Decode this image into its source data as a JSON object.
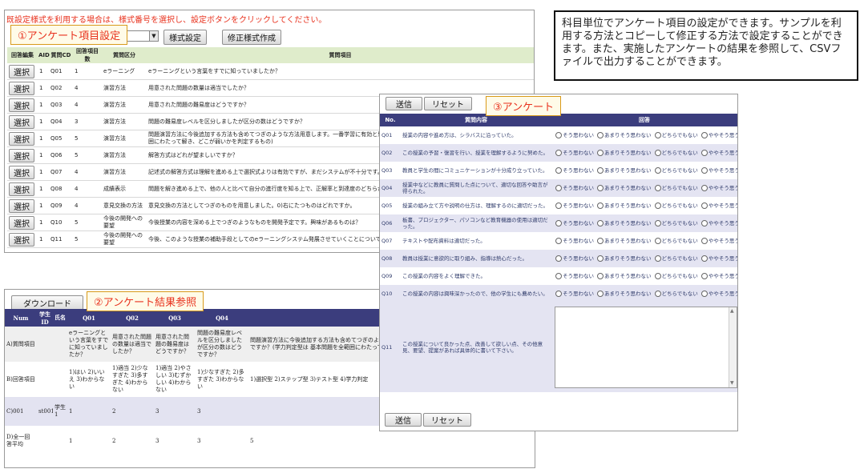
{
  "panel1": {
    "notice": "既設定様式を利用する場合は、様式番号を選択し、設定ボタンをクリックしてください。",
    "callout": "①アンケート項目設定",
    "style_button": "様式設定",
    "modify_button": "修正様式作成",
    "headers": [
      "回答編集",
      "AID",
      "質問CD",
      "回答項目数",
      "質問区分",
      "質問項目"
    ],
    "select_label": "選択",
    "rows": [
      {
        "aid": "1",
        "cd": "Q01",
        "n": "1",
        "cat": "eラーニング",
        "q": "eラーニングという言葉をすでに知っていましたか？"
      },
      {
        "aid": "1",
        "cd": "Q02",
        "n": "4",
        "cat": "演習方法",
        "q": "用意された問題の数量は適当でしたか？"
      },
      {
        "aid": "1",
        "cd": "Q03",
        "n": "4",
        "cat": "演習方法",
        "q": "用意された問題の難易度はどうですか？"
      },
      {
        "aid": "1",
        "cd": "Q04",
        "n": "3",
        "cat": "演習方法",
        "q": "問題の難易度レベルを区分しましたが区分の数はどうですか？"
      },
      {
        "aid": "1",
        "cd": "Q05",
        "n": "5",
        "cat": "演習方法",
        "q": "問題演習方法に今後追加する方法も含めてつぎのような方法用意します。一番学習に有効と思われるものはどれですか？(学力判定型は 基本問題を全範囲にわたって解き、どこが弱いかを判定するもの)"
      },
      {
        "aid": "1",
        "cd": "Q06",
        "n": "5",
        "cat": "演習方法",
        "q": "解答方式はどれが望ましいですか？"
      },
      {
        "aid": "1",
        "cd": "Q07",
        "n": "4",
        "cat": "演習方法",
        "q": "記述式の解答方式は理解を進める上で選択式よりは有効ですが、まだシステムが不十分です。解答をすぐにとりかかるべきものはどれとおもいますか？"
      },
      {
        "aid": "1",
        "cd": "Q08",
        "n": "4",
        "cat": "成績表示",
        "q": "問題を解き進める上で、他の人と比べて自分の進行度を知る上で、正解率と到達度のどちらが望ましいですか。"
      },
      {
        "aid": "1",
        "cd": "Q09",
        "n": "4",
        "cat": "意見交換の方法",
        "q": "意見交換の方法としてつぎのものを用意しました。0)右にたつものはどれですか。"
      },
      {
        "aid": "1",
        "cd": "Q10",
        "n": "5",
        "cat": "今後の開発への要望",
        "q": "今後授業の内容を深める上でつぎのようなものを開発予定です。興味があるものは？"
      },
      {
        "aid": "1",
        "cd": "Q11",
        "n": "5",
        "cat": "今後の開発への要望",
        "q": "今後、このような授業の補助手段としてのeラーニングシステム発展させていくことについて"
      }
    ]
  },
  "panel2": {
    "callout": "②アンケート結果参照",
    "download_button": "ダウンロード",
    "headers": [
      "Num",
      "学生ID",
      "氏名",
      "Q01",
      "Q02",
      "Q03",
      "Q04",
      "Q05"
    ],
    "rows": [
      {
        "num": "A)質問項目",
        "sid": "",
        "name": "",
        "q01": "eラーニングという言葉をすでに知っていましたか？",
        "q02": "用意された問題の数量は適当でしたか？",
        "q03": "用意された問題の難易度はどうですか？",
        "q04": "問題の難易度レベルを区分しましたが区分の数はどうですか？",
        "q05": "問題演習方法に今後追加する方法も含めてつぎのような方法用意します。一番学習に有効と思われるものはどれですか？(学力判定型は 基本問題を全範囲にわたって解き、どこが弱いかを判定"
      },
      {
        "num": "B)回答項目",
        "sid": "",
        "name": "",
        "q01": "1)はい 2)いいえ 3)わからない",
        "q02": "1)適当 2)少なすぎた 3)多すぎた 4)わからない",
        "q03": "1)適当 2)やさしい 3)むずかしい 4)わからない",
        "q04": "1)少なすぎた 2)多すぎた 3)わからない",
        "q05": "1)選択型 2)ステップ型 3)テスト型 4)学力判定"
      },
      {
        "num": "C)001",
        "sid": "st001",
        "name": "学生1",
        "q01": "1",
        "q02": "2",
        "q03": "3",
        "q04": "3",
        "q05": ""
      },
      {
        "num": "D)全一回答平均",
        "sid": "",
        "name": "",
        "q01": "1",
        "q02": "2",
        "q03": "3",
        "q04": "3",
        "q05": "5"
      }
    ]
  },
  "panel3": {
    "callout": "③アンケート",
    "send_button": "送信",
    "reset_button": "リセット",
    "headers": [
      "No.",
      "質問内容",
      "回答"
    ],
    "options": [
      "そう思わない",
      "あまりそう思わない",
      "どちらでもない",
      "ややそう思う",
      "そう思う"
    ],
    "rows": [
      {
        "no": "Q01",
        "q": "授業の内容や進め方は、シラバスに沿っていた。"
      },
      {
        "no": "Q02",
        "q": "この授業の予習・復習を行い、授業を理解するように努めた。"
      },
      {
        "no": "Q03",
        "q": "教員と学生の間にコミュニケーションが十分成り立っていた。"
      },
      {
        "no": "Q04",
        "q": "授業中などに教員に質問した点について、適切な回答や助言が得られた。"
      },
      {
        "no": "Q05",
        "q": "授業の組み立て方や説明の仕方は、理解するのに適切だった。"
      },
      {
        "no": "Q06",
        "q": "板書、プロジェクター、パソコンなど教育機器の使用は適切だった。"
      },
      {
        "no": "Q07",
        "q": "テキストや配布資料は適切だった。"
      },
      {
        "no": "Q08",
        "q": "教員は授業に意欲的に取り組み、指導は熱心だった。"
      },
      {
        "no": "Q09",
        "q": "この授業の内容をよく理解できた。"
      },
      {
        "no": "Q10",
        "q": "この授業の内容は興味深かったので、他の学生にも薦めたい。"
      }
    ],
    "free_no": "Q11",
    "free_q": "この授業について良かった点、改善して欲しい点、その他意見、要望、提案があれば具体的に書いて下さい。"
  },
  "description": "科目単位でアンケート項目の設定ができます。サンプルを利用する方法とコピーして修正する方法で設定することができます。また、実施したアンケートの結果を参照して、CSVファイルで出力することができます。"
}
